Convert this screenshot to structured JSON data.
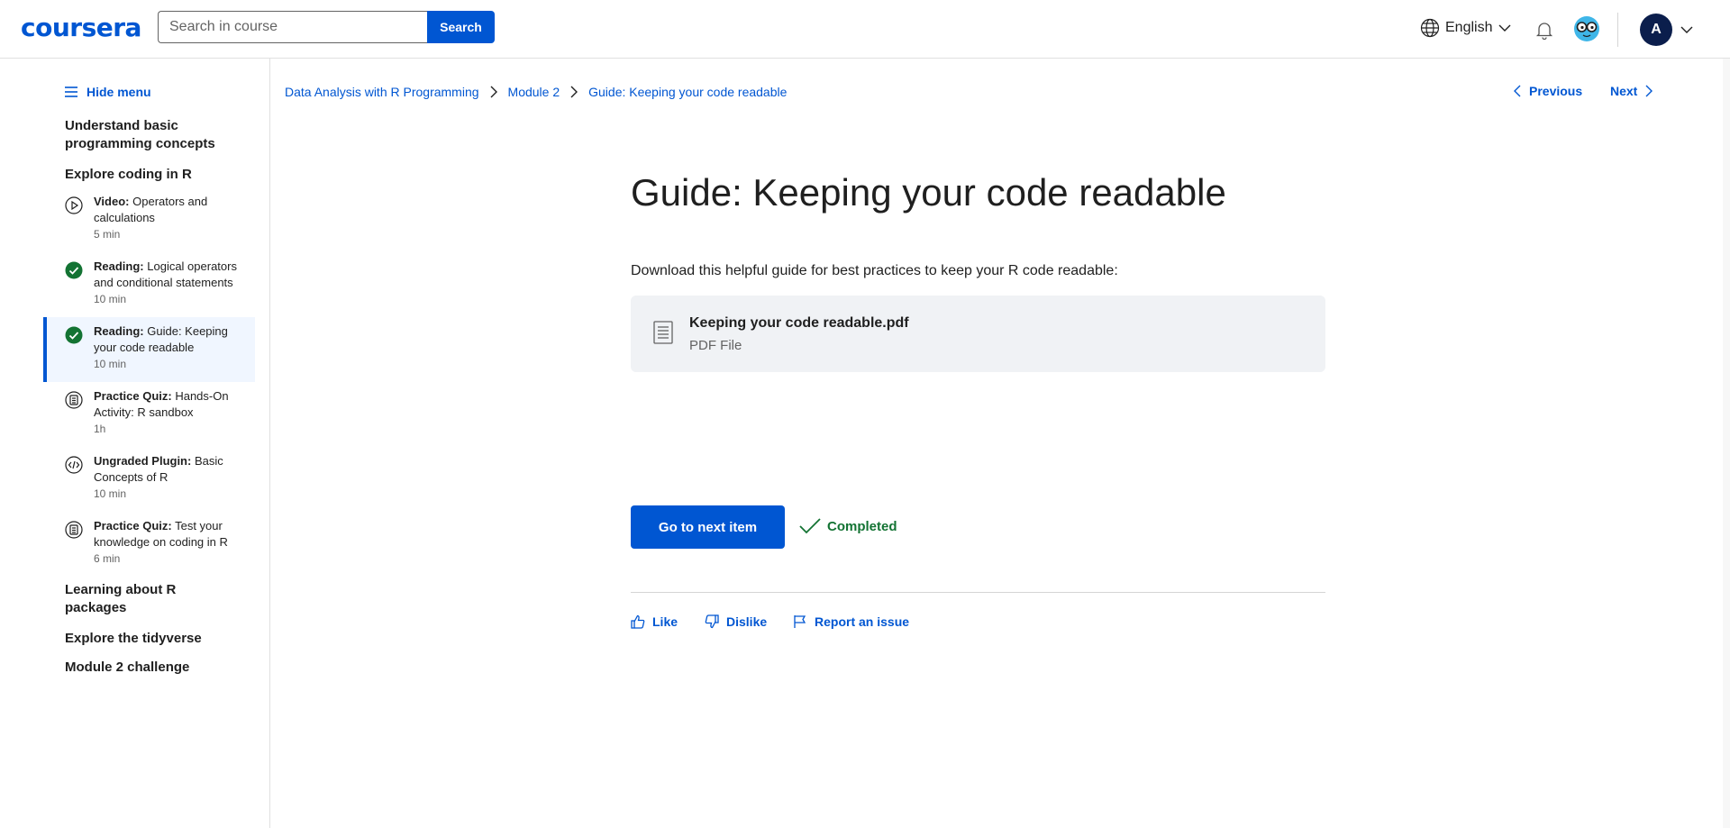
{
  "header": {
    "logo": "coursera",
    "search_placeholder": "Search in course",
    "search_button": "Search",
    "language": "English",
    "avatar_initial": "A"
  },
  "sidebar": {
    "hide_menu": "Hide menu",
    "sections": [
      "Understand basic programming concepts",
      "Explore coding in R",
      "Learning about R packages",
      "Explore the tidyverse",
      "Module 2 challenge"
    ],
    "items": [
      {
        "type": "Video:",
        "title": "Operators and calculations",
        "duration": "5 min",
        "icon": "play-icon",
        "completed": false
      },
      {
        "type": "Reading:",
        "title": "Logical operators and conditional statements",
        "duration": "10 min",
        "icon": "check-circle-icon",
        "completed": true
      },
      {
        "type": "Reading:",
        "title": "Guide: Keeping your code readable",
        "duration": "10 min",
        "icon": "check-circle-icon",
        "completed": true,
        "active": true
      },
      {
        "type": "Practice Quiz:",
        "title": "Hands-On Activity: R sandbox",
        "duration": "1h",
        "icon": "quiz-icon",
        "completed": false
      },
      {
        "type": "Ungraded Plugin:",
        "title": "Basic Concepts of R",
        "duration": "10 min",
        "icon": "code-icon",
        "completed": false
      },
      {
        "type": "Practice Quiz:",
        "title": "Test your knowledge on coding in R",
        "duration": "6 min",
        "icon": "quiz-icon",
        "completed": false
      }
    ]
  },
  "breadcrumb": [
    "Data Analysis with R Programming",
    "Module 2",
    "Guide: Keeping your code readable"
  ],
  "nav": {
    "previous": "Previous",
    "next": "Next"
  },
  "main": {
    "title": "Guide: Keeping your code readable",
    "intro": "Download this helpful guide for best practices to keep your R code readable:",
    "file": {
      "name": "Keeping your code readable.pdf",
      "type": "PDF File"
    },
    "next_button": "Go to next item",
    "completed": "Completed",
    "feedback": {
      "like": "Like",
      "dislike": "Dislike",
      "report": "Report an issue"
    }
  },
  "colors": {
    "brand": "#0056d2",
    "success": "#137333",
    "active_bg": "#f0f6ff"
  }
}
